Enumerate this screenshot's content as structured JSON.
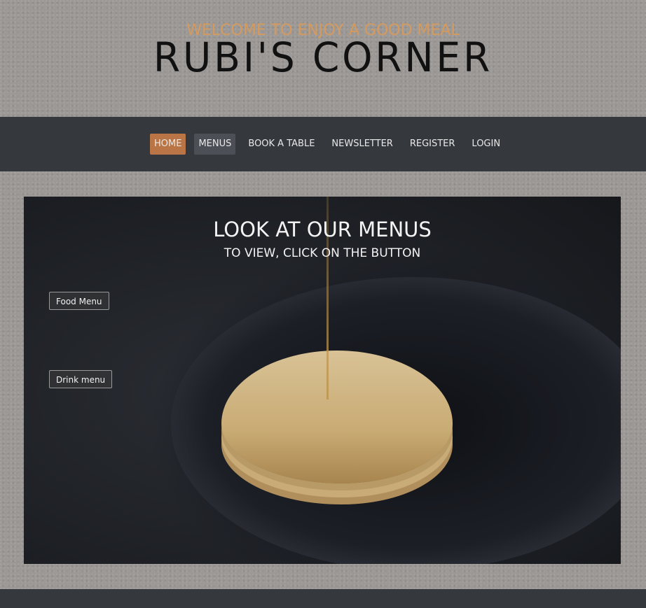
{
  "header": {
    "tagline": "WELCOME TO ENJOY A GOOD MEAL",
    "brand": "RUBI'S CORNER"
  },
  "nav": {
    "items": [
      {
        "label": "HOME",
        "state": "active"
      },
      {
        "label": "MENUS",
        "state": "hover"
      },
      {
        "label": "BOOK A TABLE",
        "state": "normal"
      },
      {
        "label": "NEWSLETTER",
        "state": "normal"
      },
      {
        "label": "REGISTER",
        "state": "normal"
      },
      {
        "label": "LOGIN",
        "state": "normal"
      }
    ]
  },
  "hero": {
    "title": "LOOK AT OUR MENUS",
    "subtitle": "TO VIEW, CLICK ON THE BUTTON",
    "food_menu_button": "Food Menu",
    "drink_menu_button": "Drink menu"
  },
  "colors": {
    "accent": "#b97545",
    "nav_bg": "#35383d",
    "tagline": "#d49a5e"
  }
}
